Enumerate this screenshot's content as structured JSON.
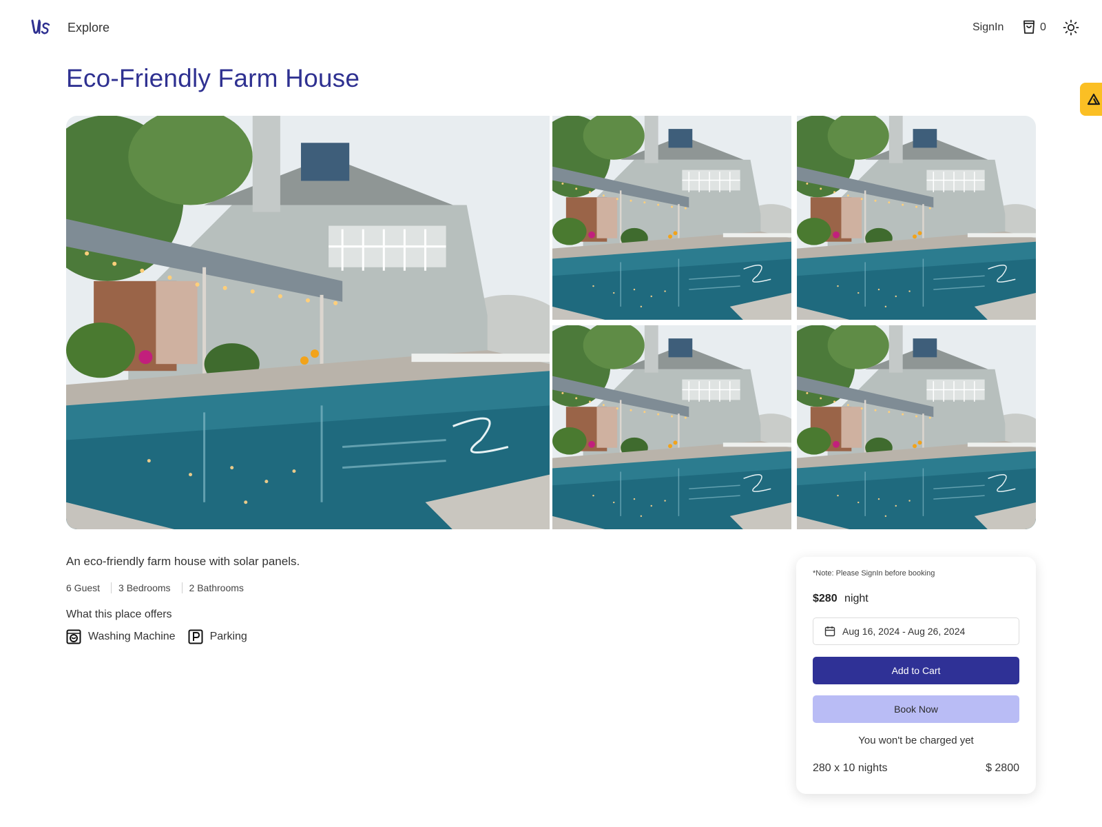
{
  "header": {
    "logo_text": "Us",
    "nav_explore": "Explore",
    "signin_label": "SignIn",
    "cart_count": "0",
    "theme_icon": "sun-icon",
    "side_tab_icon": "triangle-logo-icon"
  },
  "listing": {
    "title": "Eco-Friendly Farm House",
    "description": "An eco-friendly farm house with solar panels.",
    "stats": [
      "6 Guest",
      "3 Bedrooms",
      "2 Bathrooms"
    ],
    "offers_title": "What this place offers",
    "amenities": [
      {
        "label": "Washing Machine",
        "icon": "washing-machine-icon"
      },
      {
        "label": "Parking",
        "icon": "parking-icon"
      }
    ],
    "photos_count": 5
  },
  "booking": {
    "note": "*Note: Please SignIn before booking",
    "price": "$280",
    "price_unit": "night",
    "date_range": "Aug 16, 2024 - Aug 26, 2024",
    "add_to_cart_label": "Add to Cart",
    "book_now_label": "Book Now",
    "charged_note": "You won't be charged yet",
    "total_label": "280 x 10 nights",
    "total_amount": "$ 2800"
  },
  "colors": {
    "brand": "#2f3191",
    "primary_button": "#2f3196",
    "secondary_button": "#b9bcf5",
    "side_tab": "#fbbf24"
  }
}
